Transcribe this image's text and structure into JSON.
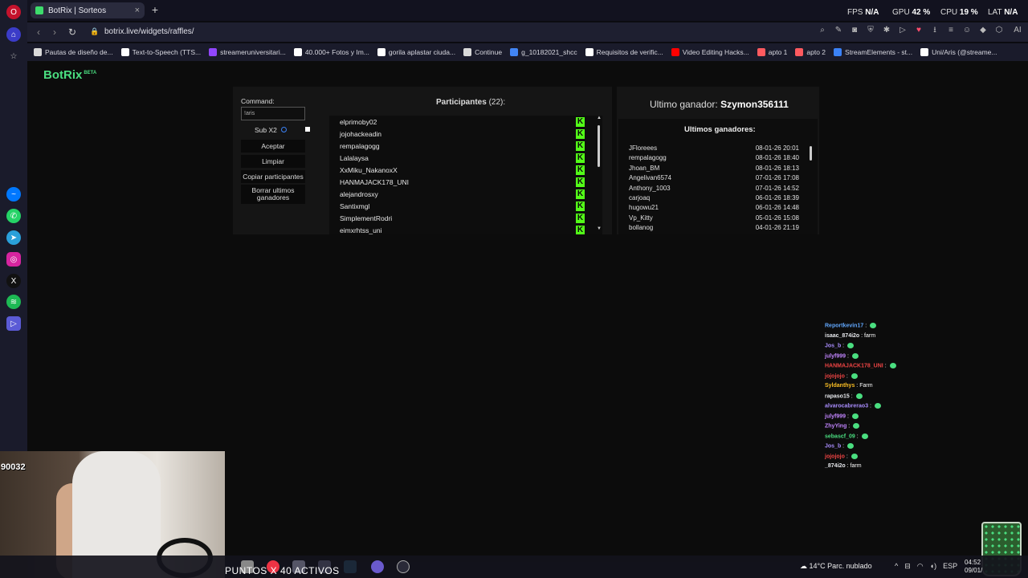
{
  "browser": {
    "tab_title": "BotRix | Sorteos",
    "url": "botrix.live/widgets/raffles/",
    "hud": {
      "fps_label": "FPS",
      "fps_value": "N/A",
      "gpu_label": "GPU",
      "gpu_value": "42 %",
      "cpu_label": "CPU",
      "cpu_value": "19 %",
      "lat_label": "LAT",
      "lat_value": "N/A"
    },
    "bookmarks": [
      {
        "label": "Pautas de diseño de...",
        "color": "#d9d9d9"
      },
      {
        "label": "Text-to-Speech (TTS...",
        "color": "#ffffff"
      },
      {
        "label": "streameruniversitari...",
        "color": "#9146ff"
      },
      {
        "label": "40.000+ Fotos y Im...",
        "color": "#ffffff"
      },
      {
        "label": "gorila aplastar ciuda...",
        "color": "#ffffff"
      },
      {
        "label": "Continue",
        "color": "#d9d9d9"
      },
      {
        "label": "g_10182021_shcc",
        "color": "#4285f4"
      },
      {
        "label": "Requisitos de verific...",
        "color": "#ffffff"
      },
      {
        "label": "Video Editing Hacks...",
        "color": "#ff0000"
      },
      {
        "label": "apto 1",
        "color": "#ff5a5f"
      },
      {
        "label": "apto 2",
        "color": "#ff5a5f"
      },
      {
        "label": "StreamElements - st...",
        "color": "#3b82f6"
      },
      {
        "label": "Uni/Aris (@streame...",
        "color": "#ffffff"
      }
    ]
  },
  "app": {
    "logo": "BotRix",
    "logo_badge": "BETA",
    "command_label": "Command:",
    "command_value": "!aris",
    "sub_label": "Sub X2",
    "buttons": {
      "accept": "Aceptar",
      "clear": "Limpiar",
      "copy": "Copiar participantes",
      "delete_line1": "Borrar ultimos",
      "delete_line2": "ganadores"
    },
    "participants_title": "Participantes",
    "participants_count": "(22):",
    "participants": [
      "elprimoby02",
      "jojohackeadin",
      "rempalagogg",
      "Lalalaysa",
      "XxMiku_NakanoxX",
      "HANMAJACK178_UNI",
      "alejandrosxy",
      "Santixmgl",
      "SimplementRodri",
      "eimxrhtss_uni"
    ],
    "last_winner_label": "Ultimo ganador:",
    "last_winner_name": "Szymon356111",
    "winners_title": "Ultimos ganadores:",
    "winners": [
      {
        "name": "JFloreees",
        "date": "08-01-26 20:01"
      },
      {
        "name": "rempalagogg",
        "date": "08-01-26 18:40"
      },
      {
        "name": "Jhoan_BM",
        "date": "08-01-26 18:13"
      },
      {
        "name": "Angelivan6574",
        "date": "07-01-26 17:08"
      },
      {
        "name": "Anthony_1003",
        "date": "07-01-26 14:52"
      },
      {
        "name": "carjoaq",
        "date": "06-01-26 18:39"
      },
      {
        "name": "hugowu21",
        "date": "06-01-26 14:48"
      },
      {
        "name": "Vp_Kitty",
        "date": "05-01-26 15:08"
      },
      {
        "name": "bollanog",
        "date": "04-01-26 21:19"
      }
    ]
  },
  "chat": [
    {
      "user": "Reportkevin17",
      "msg": "",
      "color": "#60a5fa",
      "emote": true
    },
    {
      "user": "isaac_874i2o",
      "msg": "farm",
      "color": "#e5e7eb",
      "emote": false
    },
    {
      "user": "Jos_b",
      "msg": "",
      "color": "#a78bfa",
      "emote": true
    },
    {
      "user": "julyf999",
      "msg": "",
      "color": "#c084fc",
      "emote": true
    },
    {
      "user": "HANMAJACK178_UNI",
      "msg": "",
      "color": "#ef4444",
      "emote": true
    },
    {
      "user": "jojojojo",
      "msg": "",
      "color": "#ef4444",
      "emote": true
    },
    {
      "user": "Syldanthys",
      "msg": "Farm",
      "color": "#fbbf24",
      "emote": false
    },
    {
      "user": "rapaso15",
      "msg": "",
      "color": "#e5e7eb",
      "emote": true
    },
    {
      "user": "alvarocabrerao3",
      "msg": "",
      "color": "#a78bfa",
      "emote": true
    },
    {
      "user": "julyf999",
      "msg": "",
      "color": "#c084fc",
      "emote": true
    },
    {
      "user": "ZhyYing",
      "msg": "",
      "color": "#c084fc",
      "emote": true
    },
    {
      "user": "sebascf_09",
      "msg": "",
      "color": "#4ade80",
      "emote": true
    },
    {
      "user": "Jos_b",
      "msg": "",
      "color": "#a78bfa",
      "emote": true
    },
    {
      "user": "jojojojo",
      "msg": "",
      "color": "#ef4444",
      "emote": true
    },
    {
      "user": "_874i2o",
      "msg": "farm",
      "color": "#e5e7eb",
      "emote": false
    }
  ],
  "overlay": {
    "counter": "90032",
    "points_text": "PUNTOS X 40 ACTIVOS"
  },
  "taskbar": {
    "weather": "14°C  Parc. nublado",
    "lang": "ESP",
    "time": "04:52",
    "date": "09/01/"
  }
}
